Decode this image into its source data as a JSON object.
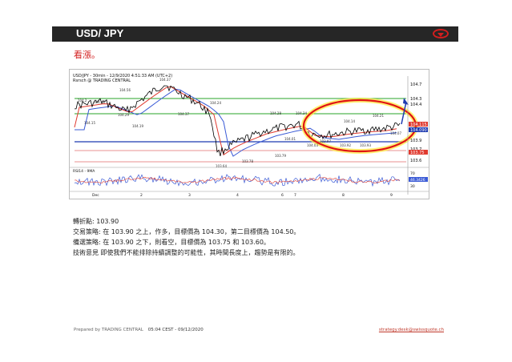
{
  "header": {
    "title": "USD/ JPY"
  },
  "view": "看漲。",
  "chart": {
    "title_line1": "USD/JPY - 30min - 12/9/2020 4:51:33 AM (UTC+2)",
    "title_line2": "Rsrsch @ TRADING CENTRAL",
    "price_labels": [
      {
        "text": "104.7"
      },
      {
        "text": "104.4"
      },
      {
        "text": "104.3"
      },
      {
        "text": "104.115"
      },
      {
        "text": "104.090"
      },
      {
        "text": "103.9"
      },
      {
        "text": "103.7"
      },
      {
        "text": "103.75"
      },
      {
        "text": "103.6"
      }
    ],
    "peak_labels": [
      "104.48",
      "104.56",
      "104.37",
      "104.2",
      "104.15",
      "104.19",
      "104.29",
      "104.24",
      "104.37",
      "104.28",
      "104.34",
      "104.01",
      "104.03",
      "104.14",
      "104.21",
      "104.07",
      "103.97",
      "103.92",
      "103.93",
      "103.64",
      "103.78",
      "103.79"
    ],
    "rsi_label": "RSI14 - 9MA",
    "rsi_values": [
      "70",
      "46.3426",
      "30"
    ],
    "date_labels": [
      "Dec",
      "2",
      "3",
      "4",
      "6",
      "7",
      "8",
      "9"
    ],
    "colors": {
      "price": "#000000",
      "ma_red": "#e03a2f",
      "ma_blue": "#3b5bd6",
      "support": "#1f3bb0",
      "resist": "#2aa52a",
      "target": "#e26b6b",
      "circle": "#e01414"
    }
  },
  "notes": {
    "pivot": "轉折點: 103.90",
    "strategy": "交易策略: 在 103.90 之上，作多，目標價為 104.30，第二目標價為 104.50。",
    "alternative": "備選策略: 在 103.90 之下，則看空，目標價為 103.75 和 103.60。",
    "comment": "技術意見 即使我們不能排除持續調整的可能性，其時間長度上，趨勢是有限的。"
  },
  "footer": {
    "prepared": "Prepared by TRADING CENTRAL",
    "timestamp": "05:04 CEST - 09/12/2020",
    "email": "strategy.desk@swissquote.ch"
  }
}
